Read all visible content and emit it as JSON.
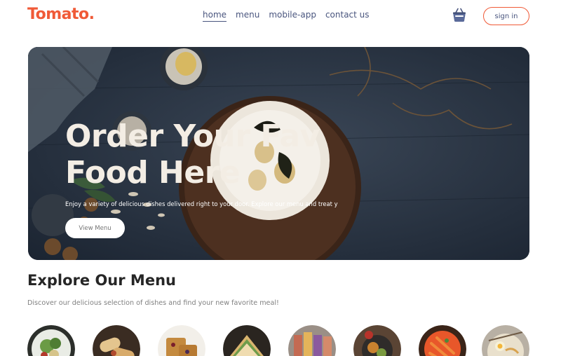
{
  "brand": {
    "logo": "Tomato.",
    "accent": "#f05a37",
    "nav_text": "#49557e"
  },
  "nav": {
    "items": [
      {
        "label": "home",
        "active": true
      },
      {
        "label": "menu",
        "active": false
      },
      {
        "label": "mobile-app",
        "active": false
      },
      {
        "label": "contact us",
        "active": false
      }
    ],
    "basket_icon": "basket-icon",
    "signin_label": "sign in"
  },
  "hero": {
    "title_line1": "Order Your Fav",
    "title_line2": "Food Here",
    "subtitle": "Enjoy a variety of delicious dishes delivered right to your door. Explore our menu and treat y",
    "button_label": "View Menu"
  },
  "explore": {
    "title": "Explore Our Menu",
    "subtitle": "Discover our delicious selection of dishes and find your new favorite meal!",
    "items": [
      {
        "icon": "salad-image"
      },
      {
        "icon": "rolls-image"
      },
      {
        "icon": "desserts-image"
      },
      {
        "icon": "sandwich-image"
      },
      {
        "icon": "cake-image"
      },
      {
        "icon": "pure-veg-image"
      },
      {
        "icon": "pasta-image"
      },
      {
        "icon": "noodles-image"
      }
    ]
  }
}
